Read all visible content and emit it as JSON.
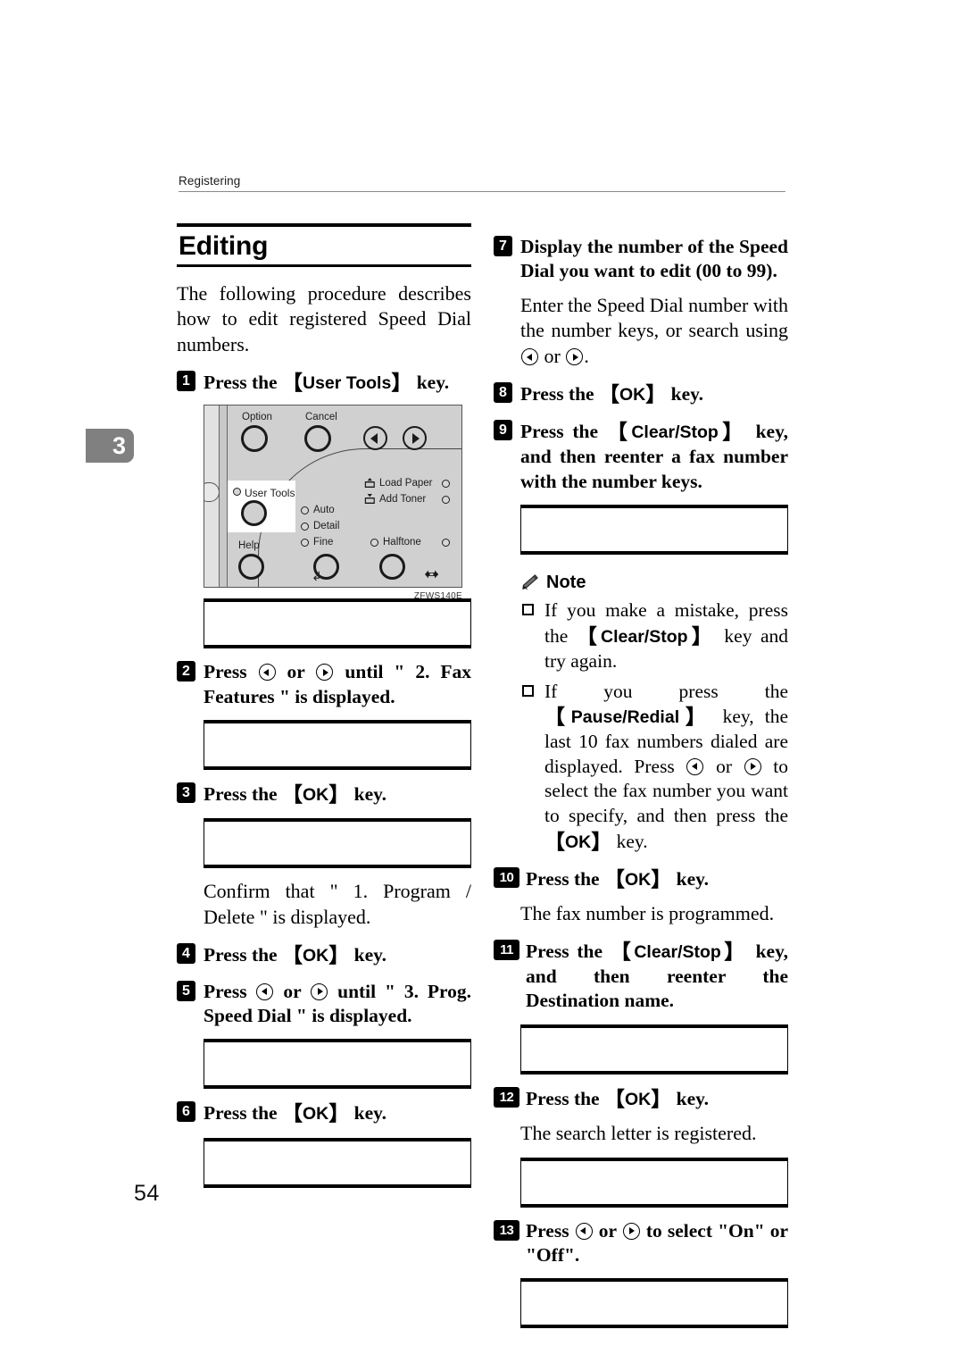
{
  "page": {
    "running_header": "Registering",
    "chapter_marker": "3",
    "page_number": "54"
  },
  "section": {
    "title": "Editing",
    "intro": "The following procedure describes how to edit registered Speed Dial numbers."
  },
  "left_column": {
    "step1": {
      "badge": "1",
      "text_before": "Press the",
      "keycap": "User Tools",
      "text_after": "key."
    },
    "figure": {
      "caption": "ZFWS140E",
      "labels": {
        "option": "Option",
        "cancel": "Cancel",
        "user_tools": "User Tools",
        "help": "Help",
        "auto": "Auto",
        "detail": "Detail",
        "fine": "Fine",
        "halftone": "Halftone",
        "load_paper": "Load Paper",
        "add_toner": "Add Toner"
      }
    },
    "step2": {
      "badge": "2",
      "text_a": "Press",
      "arrow_left": "left-arrow-key",
      "text_b": "or",
      "arrow_right": "right-arrow-key",
      "text_c": "until \" 2. Fax Features \" is displayed."
    },
    "step3": {
      "badge": "3",
      "text_before": "Press the",
      "keycap": "OK",
      "text_after": "key."
    },
    "confirm_text": "Confirm that \" 1. Program / Delete \" is displayed.",
    "step4": {
      "badge": "4",
      "text_before": "Press the",
      "keycap": "OK",
      "text_after": "key."
    },
    "step5": {
      "badge": "5",
      "text_a": "Press",
      "text_b": "or",
      "text_c": "until \" 3. Prog. Speed Dial \" is displayed."
    },
    "step6": {
      "badge": "6",
      "text_before": "Press the",
      "keycap": "OK",
      "text_after": "key."
    }
  },
  "right_column": {
    "step7": {
      "badge": "7",
      "heading": "Display the number of the Speed Dial you want to edit (00 to 99).",
      "body_a": "Enter the Speed Dial number with the number keys, or search using",
      "body_b": "or",
      "body_c": "."
    },
    "step8": {
      "badge": "8",
      "text_before": "Press the",
      "keycap": "OK",
      "text_after": "key."
    },
    "step9": {
      "badge": "9",
      "text_before": "Press the",
      "keycap": "Clear/Stop",
      "text_after": "key, and then reenter a fax number with the number keys."
    },
    "note": {
      "label": "Note",
      "items": [
        {
          "text_a": "If you make a mistake, press the",
          "keycap": "Clear/Stop",
          "text_b": "key and try again."
        },
        {
          "text_a": "If you press the",
          "keycap": "Pause/Redial",
          "text_b": "key, the last 10 fax numbers dialed are displayed. Press",
          "text_c": "or",
          "text_d": "to select the fax number you want to specify, and then press the",
          "keycap2": "OK",
          "text_e": "key."
        }
      ]
    },
    "step10": {
      "badge": "10",
      "text_before": "Press the",
      "keycap": "OK",
      "text_after": "key.",
      "result": "The fax number is programmed."
    },
    "step11": {
      "badge": "11",
      "text_before": "Press the",
      "keycap": "Clear/Stop",
      "text_after": "key, and then reenter the Destination name."
    },
    "step12": {
      "badge": "12",
      "text_before": "Press the",
      "keycap": "OK",
      "text_after": "key.",
      "result": "The search letter is registered."
    },
    "step13": {
      "badge": "13",
      "text_a": "Press",
      "text_b": "or",
      "text_c": "to select \"On\" or \"Off\"."
    }
  }
}
